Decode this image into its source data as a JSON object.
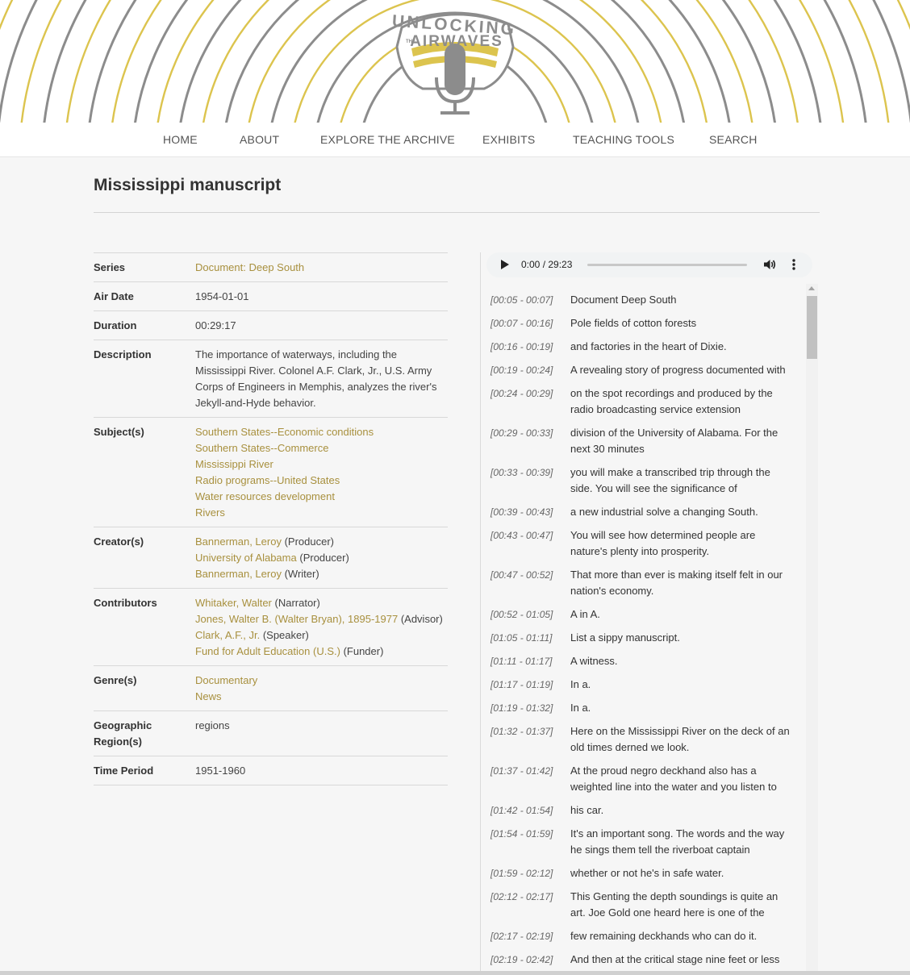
{
  "logo": {
    "line1": "UNLOCKING",
    "the": "THE",
    "line2": "AIRWAVES"
  },
  "nav": {
    "items": [
      {
        "label": "HOME"
      },
      {
        "label": "ABOUT"
      },
      {
        "label": "EXPLORE THE ARCHIVE"
      },
      {
        "label": "EXHIBITS"
      },
      {
        "label": "TEACHING TOOLS"
      },
      {
        "label": "SEARCH"
      }
    ]
  },
  "page": {
    "title": "Mississippi manuscript"
  },
  "metadata": {
    "series": {
      "label": "Series",
      "value": "Document: Deep South"
    },
    "air_date": {
      "label": "Air Date",
      "value": "1954-01-01"
    },
    "duration": {
      "label": "Duration",
      "value": "00:29:17"
    },
    "description": {
      "label": "Description",
      "value": "The importance of waterways, including the Mississippi River. Colonel A.F. Clark, Jr., U.S. Army Corps of Engineers in Memphis, analyzes the river's Jekyll-and-Hyde behavior."
    },
    "subjects": {
      "label": "Subject(s)",
      "items": [
        "Southern States--Economic conditions",
        "Southern States--Commerce",
        "Mississippi River",
        "Radio programs--United States",
        "Water resources development",
        "Rivers"
      ]
    },
    "creators": {
      "label": "Creator(s)",
      "items": [
        {
          "name": "Bannerman, Leroy",
          "role": "(Producer)"
        },
        {
          "name": "University of Alabama",
          "role": "(Producer)"
        },
        {
          "name": "Bannerman, Leroy",
          "role": "(Writer)"
        }
      ]
    },
    "contributors": {
      "label": "Contributors",
      "items": [
        {
          "name": "Whitaker, Walter",
          "role": "(Narrator)"
        },
        {
          "name": "Jones, Walter B. (Walter Bryan), 1895-1977",
          "role": "(Advisor)"
        },
        {
          "name": "Clark, A.F., Jr.",
          "role": "(Speaker)"
        },
        {
          "name": "Fund for Adult Education (U.S.)",
          "role": "(Funder)"
        }
      ]
    },
    "genres": {
      "label": "Genre(s)",
      "items": [
        "Documentary",
        "News"
      ]
    },
    "geographic": {
      "label": "Geographic Region(s)",
      "value": "regions"
    },
    "time_period": {
      "label": "Time Period",
      "value": "1951-1960"
    }
  },
  "audio": {
    "time": "0:00 / 29:23",
    "progress": 0
  },
  "transcript": [
    {
      "time": "[00:05 - 00:07]",
      "text": "Document Deep South"
    },
    {
      "time": "[00:07 - 00:16]",
      "text": "Pole fields of cotton forests"
    },
    {
      "time": "[00:16 - 00:19]",
      "text": "and factories in the heart of Dixie."
    },
    {
      "time": "[00:19 - 00:24]",
      "text": "A revealing story of progress documented with"
    },
    {
      "time": "[00:24 - 00:29]",
      "text": "on the spot recordings and produced by the radio broadcasting service extension"
    },
    {
      "time": "[00:29 - 00:33]",
      "text": "division of the University of Alabama. For the next 30 minutes"
    },
    {
      "time": "[00:33 - 00:39]",
      "text": "you will make a transcribed trip through the side. You will see the significance of"
    },
    {
      "time": "[00:39 - 00:43]",
      "text": "a new industrial solve a changing South."
    },
    {
      "time": "[00:43 - 00:47]",
      "text": "You will see how determined people are nature's plenty into prosperity."
    },
    {
      "time": "[00:47 - 00:52]",
      "text": "That more than ever is making itself felt in our nation's economy."
    },
    {
      "time": "[00:52 - 01:05]",
      "text": "A in A."
    },
    {
      "time": "[01:05 - 01:11]",
      "text": "List a sippy manuscript."
    },
    {
      "time": "[01:11 - 01:17]",
      "text": "A witness."
    },
    {
      "time": "[01:17 - 01:19]",
      "text": "In a."
    },
    {
      "time": "[01:19 - 01:32]",
      "text": "In a."
    },
    {
      "time": "[01:32 - 01:37]",
      "text": "Here on the Mississippi River on the deck of an old times derned we look."
    },
    {
      "time": "[01:37 - 01:42]",
      "text": "At the proud negro deckhand also has a weighted line into the water and you listen to"
    },
    {
      "time": "[01:42 - 01:54]",
      "text": "his car."
    },
    {
      "time": "[01:54 - 01:59]",
      "text": "It's an important song. The words and the way he sings them tell the riverboat captain"
    },
    {
      "time": "[01:59 - 02:12]",
      "text": "whether or not he's in safe water."
    },
    {
      "time": "[02:12 - 02:17]",
      "text": "This Genting the depth soundings is quite an art. Joe Gold one heard here is one of the"
    },
    {
      "time": "[02:17 - 02:19]",
      "text": "few remaining deckhands who can do it."
    },
    {
      "time": "[02:19 - 02:42]",
      "text": "And then at the critical stage nine feet or less"
    }
  ],
  "colors": {
    "gold": "#dcc44e",
    "grey": "#8c8c8c",
    "link": "#a8903e"
  }
}
